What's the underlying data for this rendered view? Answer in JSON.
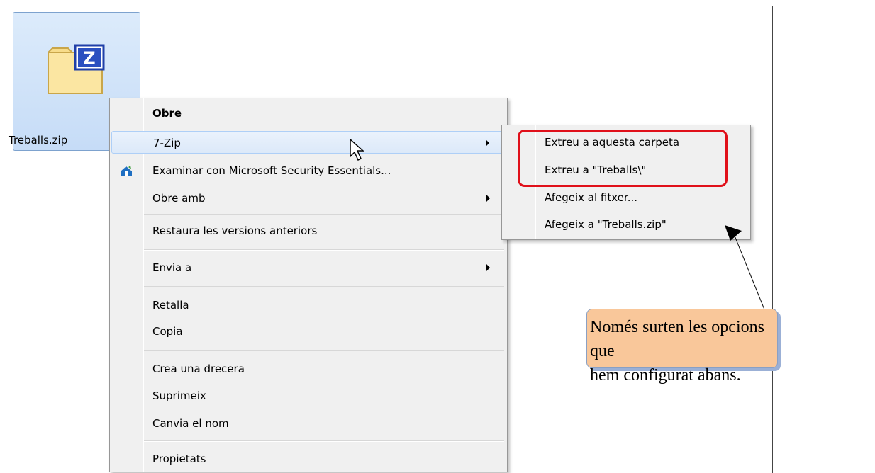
{
  "file": {
    "name": "Treballs.zip",
    "icon": "zip-file-icon"
  },
  "context_menu": {
    "items": [
      {
        "label": "Obre"
      },
      {
        "label": "7-Zip"
      },
      {
        "label": "Examinar con Microsoft Security Essentials..."
      },
      {
        "label": "Obre amb"
      },
      {
        "label": "Restaura les versions anteriors"
      },
      {
        "label": "Envia a"
      },
      {
        "label": "Retalla"
      },
      {
        "label": "Copia"
      },
      {
        "label": "Crea una drecera"
      },
      {
        "label": "Suprimeix"
      },
      {
        "label": "Canvia el nom"
      },
      {
        "label": "Propietats"
      }
    ]
  },
  "submenu_7zip": {
    "items": [
      {
        "label": "Extreu a aquesta carpeta"
      },
      {
        "label": "Extreu a \"Treballs\\\""
      },
      {
        "label": "Afegeix al fitxer..."
      },
      {
        "label": "Afegeix a \"Treballs.zip\""
      }
    ]
  },
  "callout": {
    "line1": "Només surten les opcions que",
    "line2": "hem configurat abans."
  },
  "colors": {
    "highlight_box": "#e0101a",
    "callout_fill": "#f9c79a",
    "menu_bg": "#f0f0f0",
    "selection": "#dce9f9"
  }
}
